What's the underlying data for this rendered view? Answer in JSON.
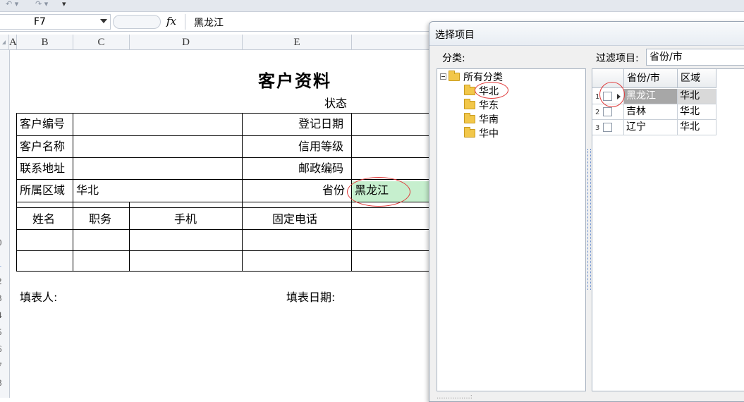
{
  "formula_bar": {
    "cell_ref": "F7",
    "fx_label": "fx",
    "content": "黑龙江"
  },
  "columns": [
    "A",
    "B",
    "C",
    "D",
    "E"
  ],
  "rows": [
    "0",
    "1",
    "2",
    "3",
    "4",
    "5",
    "6",
    "7",
    "8"
  ],
  "sheet": {
    "title": "客户资料",
    "status_label": "状态",
    "labels": {
      "customer_no": "客户编号",
      "customer_name": "客户名称",
      "address": "联系地址",
      "region": "所属区域",
      "register_date": "登记日期",
      "credit_level": "信用等级",
      "postcode": "邮政编码",
      "province": "省份"
    },
    "values": {
      "region": "华北",
      "province": "黑龙江"
    },
    "contact_headers": [
      "姓名",
      "职务",
      "手机",
      "固定电话"
    ],
    "footer": {
      "filler": "填表人:",
      "fill_date": "填表日期:"
    }
  },
  "dialog": {
    "title": "选择项目",
    "category_label": "分类:",
    "filter_label": "过滤项目:",
    "filter_value": "省份/市",
    "tree": {
      "root": "所有分类",
      "children": [
        "华北",
        "华东",
        "华南",
        "华中"
      ]
    },
    "grid": {
      "headers": [
        "省份/市",
        "区域"
      ],
      "rows": [
        {
          "num": "1",
          "province": "黑龙江",
          "region": "华北"
        },
        {
          "num": "2",
          "province": "吉林",
          "region": "华北"
        },
        {
          "num": "3",
          "province": "辽宁",
          "region": "华北"
        }
      ]
    },
    "footer_text": "...............:"
  },
  "colors": {
    "highlight_fill": "#c6efce",
    "annotation_red": "#e03c3c",
    "selected_row": "#a7a7a7"
  }
}
